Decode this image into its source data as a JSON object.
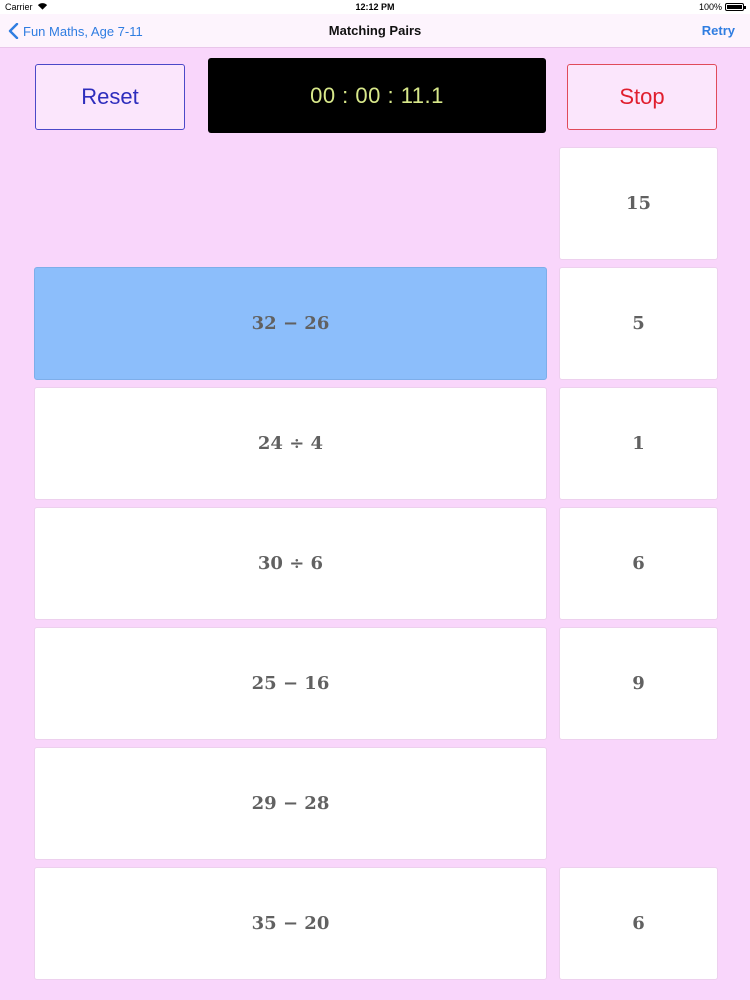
{
  "status": {
    "carrier": "Carrier",
    "time": "12:12 PM",
    "battery": "100%"
  },
  "nav": {
    "back_label": "Fun Maths, Age 7-11",
    "title": "Matching Pairs",
    "retry_label": "Retry"
  },
  "controls": {
    "reset_label": "Reset",
    "timer": "00 : 00 : 11.1",
    "stop_label": "Stop"
  },
  "questions": [
    "",
    "32 − 26",
    "24 ÷ 4",
    "30 ÷ 6",
    "25 − 16",
    "29 − 28",
    "35 − 20"
  ],
  "answers": [
    "15",
    "5",
    "1",
    "6",
    "9",
    "",
    "6"
  ],
  "selected_question_index": 1,
  "colors": {
    "background": "#f9d6fb",
    "selected": "#8cbefb",
    "link": "#2f7de1",
    "reset": "#2e2dbd",
    "stop": "#e01e2e",
    "timer_text": "#d8e88a"
  }
}
